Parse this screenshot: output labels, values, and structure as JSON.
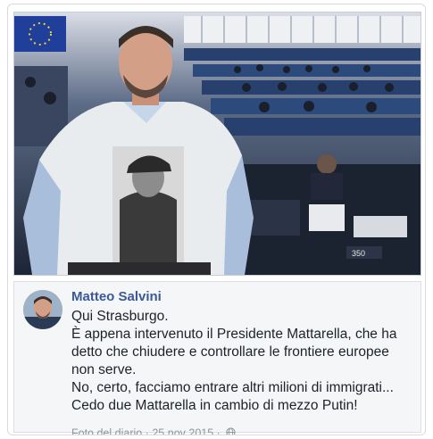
{
  "post": {
    "author": "Matteo Salvini",
    "lines": [
      "Qui Strasburgo.",
      "È appena intervenuto il Presidente Mattarella, che ha",
      "detto che chiudere e controllare le frontiere europee",
      "non serve.",
      "No, certo, facciamo entrare altri milioni di immigrati...",
      "Cedo due Mattarella in cambio di mezzo Putin!"
    ],
    "meta": {
      "source": "Foto del diario",
      "separator": "·",
      "date": "25 nov 2015",
      "separator2": "·"
    }
  },
  "photo": {
    "desk_sign": "350",
    "content": "photo-parliament-chamber"
  },
  "icons": {
    "privacy": "globe-icon"
  },
  "colors": {
    "author_link": "#3b5998",
    "meta_text": "#90949c",
    "post_bg": "#f5f6f8"
  }
}
